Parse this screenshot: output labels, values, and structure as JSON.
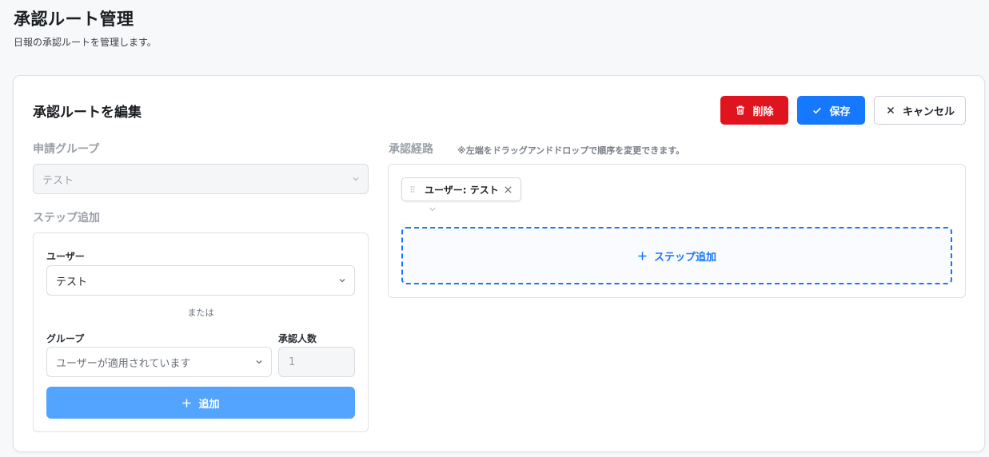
{
  "page": {
    "title": "承認ルート管理",
    "subtitle": "日報の承認ルートを管理します。"
  },
  "card": {
    "title": "承認ルートを編集",
    "buttons": {
      "delete": "削除",
      "save": "保存",
      "cancel": "キャンセル"
    }
  },
  "group_section": {
    "label": "申請グループ",
    "value": "テスト"
  },
  "step_add": {
    "label": "ステップ追加",
    "user_label": "ユーザー",
    "user_value": "テスト",
    "or_text": "または",
    "group_label": "グループ",
    "group_placeholder": "ユーザーが適用されています",
    "count_label": "承認人数",
    "count_value": "1",
    "add_button": "追加"
  },
  "route": {
    "label": "承認経路",
    "note": "※左端をドラッグアンドドロップで順序を変更できます。",
    "steps": [
      {
        "label": "ユーザー: テスト"
      }
    ],
    "add_step": "ステップ追加"
  },
  "colors": {
    "delete": "#e0141e",
    "primary": "#1677ff",
    "add_button": "#52a4ff"
  }
}
